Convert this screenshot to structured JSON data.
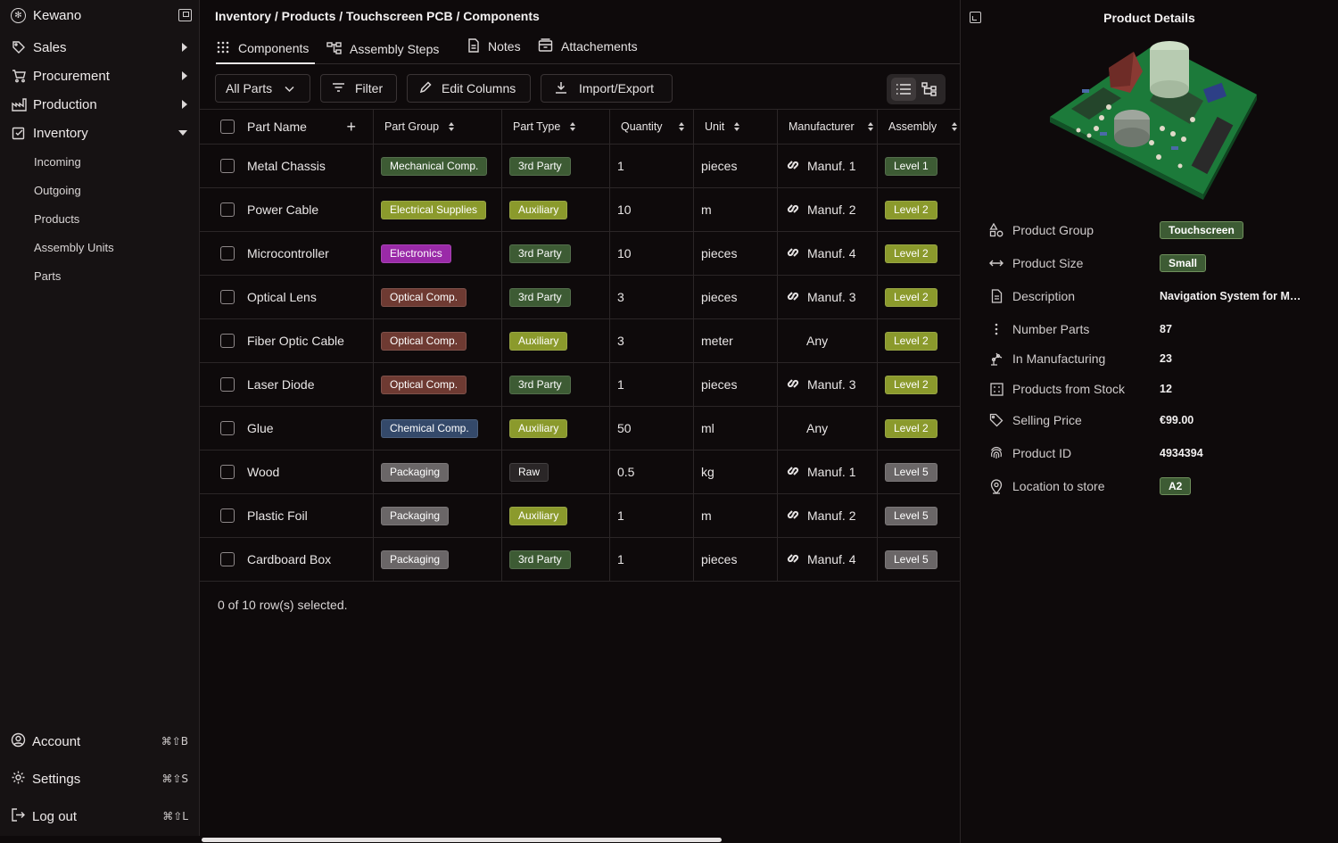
{
  "sidebar": {
    "brand": "Kewano",
    "nav": [
      {
        "label": "Sales",
        "icon": "tag-icon"
      },
      {
        "label": "Procurement",
        "icon": "cart-icon"
      },
      {
        "label": "Production",
        "icon": "factory-icon"
      },
      {
        "label": "Inventory",
        "icon": "inventory-icon"
      }
    ],
    "inventory_sub": [
      "Incoming",
      "Outgoing",
      "Products",
      "Assembly Units",
      "Parts"
    ],
    "footer": [
      {
        "label": "Account",
        "shortcut": "⌘⇧B"
      },
      {
        "label": "Settings",
        "shortcut": "⌘⇧S"
      },
      {
        "label": "Log out",
        "shortcut": "⌘⇧L"
      }
    ]
  },
  "main": {
    "breadcrumb": "Inventory / Products / Touchscreen PCB / Components",
    "tabs": [
      "Components",
      "Assembly Steps",
      "Notes",
      "Attachements"
    ],
    "toolbar": {
      "parts_select": "All Parts",
      "filter": "Filter",
      "edit_columns": "Edit Columns",
      "import_export": "Import/Export"
    },
    "columns": [
      "Part Name",
      "Part Group",
      "Part Type",
      "Quantity",
      "Unit",
      "Manufacturer",
      "Assembly"
    ],
    "rows": [
      {
        "name": "Metal Chassis",
        "group": "Mechanical Comp.",
        "type": "3rd Party",
        "qty": "1",
        "unit": "pieces",
        "manuf": "Manuf. 1",
        "assembly": "Level 1"
      },
      {
        "name": "Power Cable",
        "group": "Electrical Supplies",
        "type": "Auxiliary",
        "qty": "10",
        "unit": "m",
        "manuf": "Manuf. 2",
        "assembly": "Level 2"
      },
      {
        "name": "Microcontroller",
        "group": "Electronics",
        "type": "3rd Party",
        "qty": "10",
        "unit": "pieces",
        "manuf": "Manuf. 4",
        "assembly": "Level 2"
      },
      {
        "name": "Optical Lens",
        "group": "Optical Comp.",
        "type": "3rd Party",
        "qty": "3",
        "unit": "pieces",
        "manuf": "Manuf. 3",
        "assembly": "Level 2"
      },
      {
        "name": "Fiber Optic Cable",
        "group": "Optical Comp.",
        "type": "Auxiliary",
        "qty": "3",
        "unit": "meter",
        "manuf": "Any",
        "assembly": "Level 2"
      },
      {
        "name": "Laser Diode",
        "group": "Optical Comp.",
        "type": "3rd Party",
        "qty": "1",
        "unit": "pieces",
        "manuf": "Manuf. 3",
        "assembly": "Level 2"
      },
      {
        "name": "Glue",
        "group": "Chemical Comp.",
        "type": "Auxiliary",
        "qty": "50",
        "unit": "ml",
        "manuf": "Any",
        "assembly": "Level 2"
      },
      {
        "name": "Wood",
        "group": "Packaging",
        "type": "Raw",
        "qty": "0.5",
        "unit": "kg",
        "manuf": "Manuf. 1",
        "assembly": "Level 5"
      },
      {
        "name": "Plastic Foil",
        "group": "Packaging",
        "type": "Auxiliary",
        "qty": "1",
        "unit": "m",
        "manuf": "Manuf. 2",
        "assembly": "Level 5"
      },
      {
        "name": "Cardboard Box",
        "group": "Packaging",
        "type": "3rd Party",
        "qty": "1",
        "unit": "pieces",
        "manuf": "Manuf. 4",
        "assembly": "Level 5"
      }
    ],
    "selection_status": "0 of 10 row(s) selected."
  },
  "badge_colors": {
    "Mechanical Comp.": "#3d5b34",
    "Electrical Supplies": "#8b9a2c",
    "Electronics": "#9a2aa8",
    "Optical Comp.": "#6e3a32",
    "Chemical Comp.": "#34496a",
    "Packaging": "#6a6667",
    "3rd Party": "#3d5b34",
    "Auxiliary": "#8b9a2c",
    "Raw": "#2a2627",
    "Level 1": "#3d5b34",
    "Level 2": "#8b9a2c",
    "Level 5": "#6a6667"
  },
  "details": {
    "title": "Product Details",
    "props": [
      {
        "label": "Product Group",
        "value": "Touchscreen",
        "badge": true,
        "icon": "shapes-icon"
      },
      {
        "label": "Product Size",
        "value": "Small",
        "badge": true,
        "icon": "arrows-horizontal-icon"
      },
      {
        "label": "Description",
        "value": "Navigation System for Medical Devices",
        "badge": false,
        "icon": "document-icon"
      },
      {
        "label": "Number Parts",
        "value": "87",
        "badge": false,
        "icon": "dots-vertical-icon"
      },
      {
        "label": "In Manufacturing",
        "value": "23",
        "badge": false,
        "icon": "robot-arm-icon"
      },
      {
        "label": "Products from Stock",
        "value": "12",
        "badge": false,
        "icon": "grid-icon"
      },
      {
        "label": "Selling Price",
        "value": "€99.00",
        "badge": false,
        "icon": "price-tag-icon"
      },
      {
        "label": "Product ID",
        "value": "4934394",
        "badge": false,
        "icon": "fingerprint-icon"
      },
      {
        "label": "Location to store",
        "value": "A2",
        "badge": true,
        "icon": "location-pin-icon"
      }
    ]
  }
}
